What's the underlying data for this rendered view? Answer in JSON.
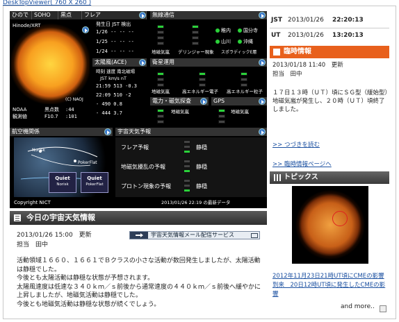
{
  "top_link": "DeskTopViewer( 760 X 260 )",
  "viewer": {
    "tabs": [
      "ひので",
      "SOHO",
      "黒点",
      "フレア"
    ],
    "sun_caption": "Hinode/XRT",
    "sun_copyright": "(C) NAOJ",
    "sunspot": {
      "label": "黒点数",
      "value": ":44",
      "f107_label": "F10.7",
      "f107_value": ":101",
      "noaa_label": "NOAA",
      "obs_label": "観測値"
    },
    "flare": {
      "header": "発生日 JST 検出",
      "rows": [
        "1/26 -- -- --",
        "1/25 -- -- --",
        "1/24 -- -- --"
      ]
    },
    "wireless": {
      "title": "無線通信",
      "labels": [
        "稚内",
        "国分寺",
        "山川",
        "沖縄"
      ],
      "caption1": "地磁気嵐",
      "caption2": "デリンジャー現象",
      "caption3": "スポラディックE層"
    },
    "ace": {
      "title": "太陽風(ACE)",
      "header1": "時刻 速度 南北磁場",
      "header2": "JST km/s nT",
      "rows": [
        "21:59 513 -0.3",
        "22:09 510 -2",
        "- 490 0.8",
        "- 444 3.7"
      ]
    },
    "satellite": {
      "title": "衛星運用",
      "caption1": "地磁気嵐",
      "caption2": "高エネルギー電子",
      "caption3": "高エネルギー粒子"
    },
    "power": {
      "title": "電力・磁気探査",
      "caption": "地磁気嵐"
    },
    "gps": {
      "title": "GPS",
      "caption": "地磁気嵐"
    },
    "aviation": {
      "title": "航空機関係",
      "labels": [
        "Norisk",
        "PokerFlat",
        "Quiet",
        "Quiet",
        "Norisk",
        "PokerFlat"
      ]
    },
    "forecast": {
      "title": "宇宙天気予報",
      "rows": [
        {
          "label": "フレア予報",
          "status": "静穏"
        },
        {
          "label": "地磁気擾乱の予報",
          "status": "静穏"
        },
        {
          "label": "プロトン現象の予報",
          "status": "静穏"
        }
      ]
    },
    "copyright": "Copyright NICT",
    "latest": "2013/01/26 22:19 の最新データ"
  },
  "today": {
    "title": "今日の宇宙天気情報",
    "date": "2013/01/26 15:00　更新",
    "person": "担当　田中",
    "mail_button": "宇宙天気情報メール配信サービス",
    "body": [
      "活動領域１６６０、１６６１でＢクラスの小さな活動が数回発生しましたが、太陽活動は静穏でした。",
      "今後とも太陽活動は静穏な状態が予想されます。",
      "太陽風速度は低速な３４０ｋｍ／ｓ前後から通常速度の４４０ｋｍ／ｓ前後へ緩やかに上昇しましたが、地磁気活動は静穏でした。",
      "今後とも地磁気活動は静穏な状態が続くでしょう。"
    ]
  },
  "clock": {
    "jst_label": "JST",
    "jst_date": "2013/01/26",
    "jst_time": "22:20:13",
    "ut_label": "UT",
    "ut_date": "2013/01/26",
    "ut_time": "13:20:13"
  },
  "bulletin": {
    "title": "臨時情報",
    "date": "2013/01/18 11:40　更新",
    "person": "担当　田中",
    "text": "１７日１３時（ＵＴ）頃にＳＧ型（緩始型）地磁気嵐が発生し、２０時（ＵＴ）頃終了しました。",
    "more": ">> つづきを読む",
    "page": ">> 臨時情報ページへ"
  },
  "topics": {
    "title": "トピックス",
    "link": "2012年11月23日21時UT頃にCMEの影響到来　20日12時UT頃に発生したCMEの影響",
    "more": "and more.."
  },
  "colors": {
    "accent_orange": "#e8601c",
    "link_blue": "#1a4fa0",
    "lamp_green": "#2bd13a"
  }
}
